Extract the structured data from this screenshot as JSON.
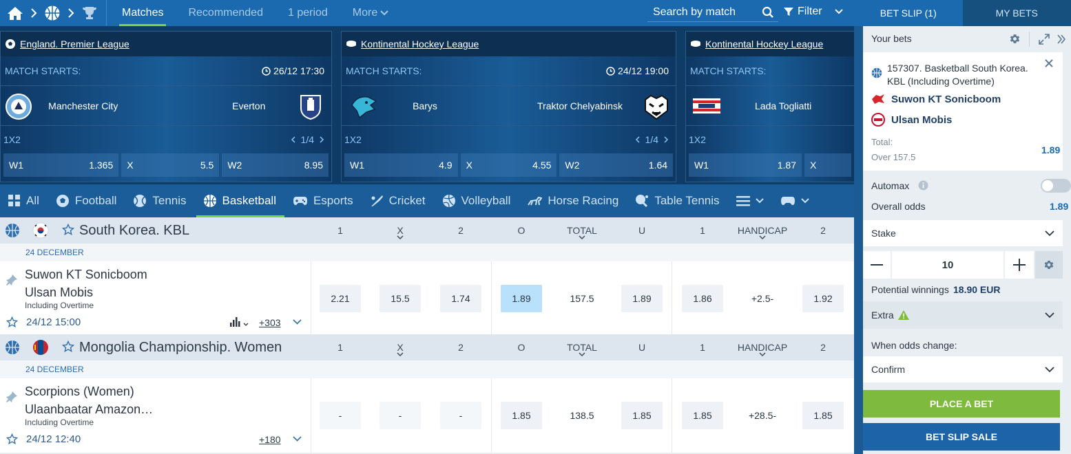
{
  "colors": {
    "brand_blue": "#1b6aaf",
    "accent_green": "#7ad14a",
    "place_bet_green": "#7dba3e",
    "selected_odd": "#b9e1fb",
    "link_blue": "#2b6ab0"
  },
  "topnav": {
    "icons": [
      "home-icon",
      "chevron-right-icon",
      "basketball-icon",
      "chevron-right-icon",
      "trophy-icon"
    ],
    "tabs": [
      "Matches",
      "Recommended",
      "1 period",
      "More"
    ],
    "search_placeholder": "Search by match",
    "filter_label": "Filter"
  },
  "cards": [
    {
      "league": "England. Premier League",
      "starts_label": "MATCH STARTS:",
      "datetime": "26/12 17:30",
      "team1": "Manchester City",
      "team2": "Everton",
      "market": "1X2",
      "pager": "1/4",
      "odds": [
        {
          "label": "W1",
          "value": "1.365"
        },
        {
          "label": "X",
          "value": "5.5"
        },
        {
          "label": "W2",
          "value": "8.95"
        }
      ]
    },
    {
      "league": "Kontinental Hockey League",
      "starts_label": "MATCH STARTS:",
      "datetime": "24/12 19:00",
      "team1": "Barys",
      "team2": "Traktor Chelyabinsk",
      "market": "1X2",
      "pager": "1/4",
      "odds": [
        {
          "label": "W1",
          "value": "4.9"
        },
        {
          "label": "X",
          "value": "4.55"
        },
        {
          "label": "W2",
          "value": "1.64"
        }
      ]
    },
    {
      "league": "Kontinental Hockey League",
      "starts_label": "MATCH STARTS:",
      "team1": "Lada Togliatti",
      "market": "1X2",
      "odds": [
        {
          "label": "W1",
          "value": "1.87"
        },
        {
          "label": "X",
          "value": ""
        }
      ]
    }
  ],
  "sports": [
    "All",
    "Football",
    "Tennis",
    "Basketball",
    "Esports",
    "Cricket",
    "Volleyball",
    "Horse Racing",
    "Table Tennis"
  ],
  "columns": [
    "1",
    "X",
    "2",
    "O",
    "TOTAL",
    "U",
    "1",
    "HANDICAP",
    "2"
  ],
  "leagues": [
    {
      "name": "South Korea. KBL",
      "date": "24 DECEMBER",
      "event": {
        "team1": "Suwon KT Sonicboom",
        "team2": "Ulsan Mobis",
        "note": "Including Overtime",
        "time": "24/12 15:00",
        "more": "+303",
        "odds": [
          "2.21",
          "15.5",
          "1.74",
          "1.89",
          "157.5",
          "1.89",
          "1.86",
          "+2.5-",
          "1.92"
        ]
      }
    },
    {
      "name": "Mongolia Championship. Women",
      "date": "24 DECEMBER",
      "event": {
        "team1": "Scorpions (Women)",
        "team2": "Ulaanbaatar Amazon…",
        "note": "Including Overtime",
        "time": "24/12 12:40",
        "more": "+180",
        "odds": [
          "-",
          "-",
          "-",
          "1.85",
          "138.5",
          "1.85",
          "1.85",
          "+28.5-",
          "1.85"
        ]
      }
    }
  ],
  "slip": {
    "tab_active": "BET SLIP (1)",
    "tab_other": "MY BETS",
    "your_bets": "Your bets",
    "bet": {
      "title": "157307. Basketball South Korea. KBL (Including Overtime)",
      "team1": "Suwon KT Sonicboom",
      "team2": "Ulsan Mobis",
      "total_label": "Total:",
      "selection": "Over 157.5",
      "odd": "1.89"
    },
    "automax": "Automax",
    "overall_odds_label": "Overall odds",
    "overall_odds": "1.89",
    "stake_label": "Stake",
    "stake_value": "10",
    "potential_label": "Potential winnings",
    "potential_value": "18.90 EUR",
    "extra_label": "Extra",
    "odds_change_label": "When odds change:",
    "odds_change_value": "Confirm",
    "place_bet": "PLACE A BET",
    "slip_sale": "BET SLIP SALE"
  }
}
